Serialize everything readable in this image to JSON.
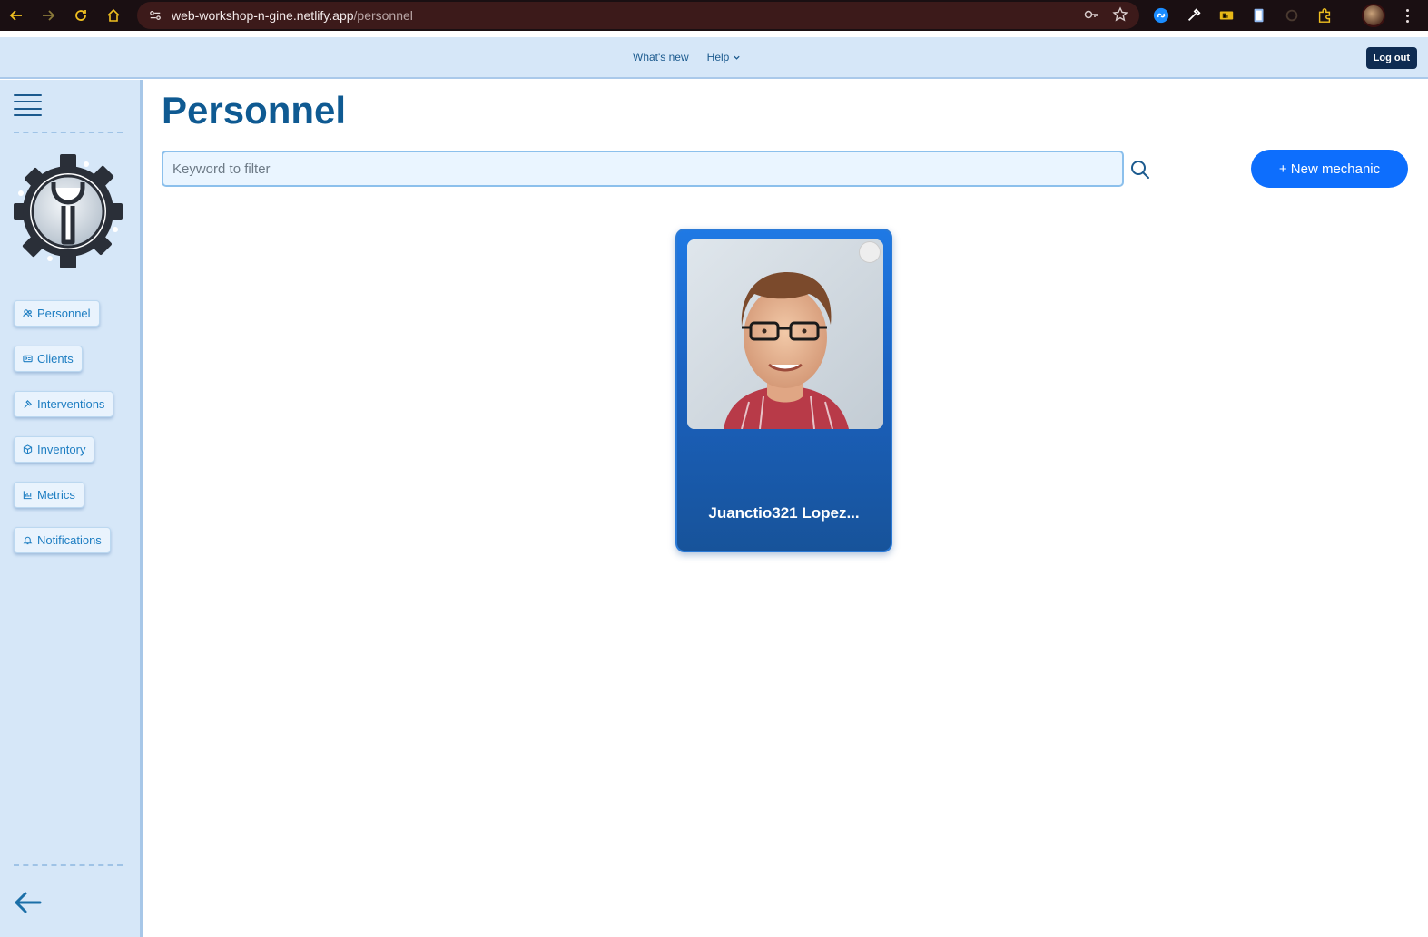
{
  "browser": {
    "url_host": "web-workshop-n-gine.netlify.app",
    "url_path": "/personnel"
  },
  "topbar": {
    "whats_new": "What's new",
    "help": "Help",
    "logout": "Log out"
  },
  "sidebar": {
    "items": [
      {
        "label": "Personnel",
        "icon": "users-icon"
      },
      {
        "label": "Clients",
        "icon": "id-card-icon"
      },
      {
        "label": "Interventions",
        "icon": "hammer-icon"
      },
      {
        "label": "Inventory",
        "icon": "box-icon"
      },
      {
        "label": "Metrics",
        "icon": "bar-chart-icon"
      },
      {
        "label": "Notifications",
        "icon": "bell-icon"
      }
    ]
  },
  "main": {
    "title": "Personnel",
    "search_placeholder": "Keyword to filter",
    "new_button": "+ New mechanic",
    "cards": [
      {
        "name": "Juanctio321 Lopez..."
      }
    ]
  },
  "colors": {
    "primary": "#0d6efd",
    "title": "#0f5a92",
    "sidebar_bg": "#d6e7f8",
    "browser_bar": "#1a0f12"
  }
}
